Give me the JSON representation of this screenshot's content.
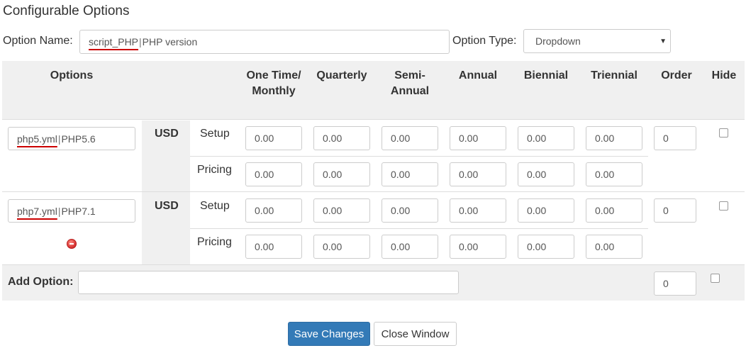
{
  "page": {
    "title": "Configurable Options"
  },
  "option_name": {
    "label": "Option Name:",
    "value_key": "script_PHP",
    "value_sep": "|",
    "value_text": "PHP version"
  },
  "option_type": {
    "label": "Option Type:",
    "selected": "Dropdown"
  },
  "table": {
    "headers": {
      "options": "Options",
      "one_time_monthly": "One Time/ Monthly",
      "quarterly": "Quarterly",
      "semi_annual": "Semi- Annual",
      "annual": "Annual",
      "biennial": "Biennial",
      "triennial": "Triennial",
      "order": "Order",
      "hide": "Hide"
    },
    "rows": [
      {
        "name_key": "php5.yml",
        "name_sep": "|",
        "name_text": "PHP5.6",
        "currency": "USD",
        "setup_label": "Setup",
        "pricing_label": "Pricing",
        "setup": [
          "0.00",
          "0.00",
          "0.00",
          "0.00",
          "0.00",
          "0.00"
        ],
        "pricing": [
          "0.00",
          "0.00",
          "0.00",
          "0.00",
          "0.00",
          "0.00"
        ],
        "order": "0"
      },
      {
        "name_key": "php7.yml",
        "name_sep": "|",
        "name_text": "PHP7.1",
        "currency": "USD",
        "setup_label": "Setup",
        "pricing_label": "Pricing",
        "setup": [
          "0.00",
          "0.00",
          "0.00",
          "0.00",
          "0.00",
          "0.00"
        ],
        "pricing": [
          "0.00",
          "0.00",
          "0.00",
          "0.00",
          "0.00",
          "0.00"
        ],
        "order": "0"
      }
    ]
  },
  "add_option": {
    "label": "Add Option:",
    "value": "",
    "order": "0"
  },
  "buttons": {
    "save": "Save Changes",
    "close": "Close Window"
  },
  "colors": {
    "primary": "#337ab7",
    "band": "#f0f0f0",
    "underline": "#cc0000",
    "remove": "#d32f2f"
  }
}
